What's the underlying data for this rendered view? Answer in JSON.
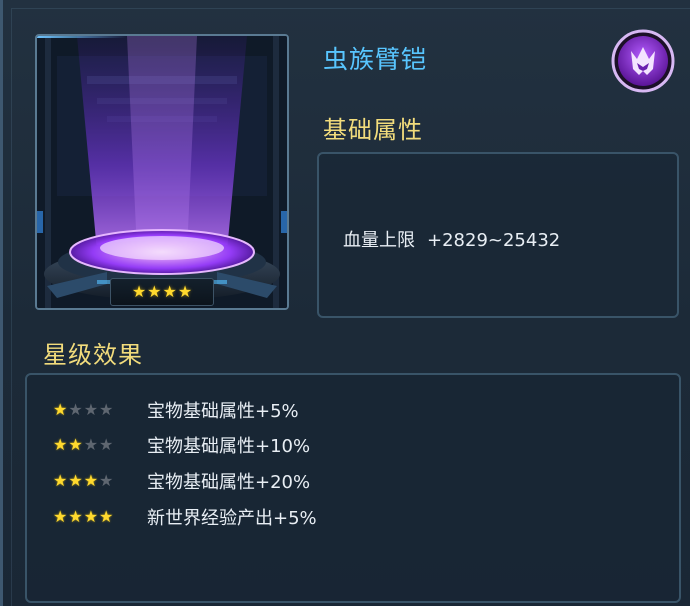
{
  "item": {
    "name": "虫族臂铠",
    "star_count": 4,
    "stars": "★★★★",
    "emblem_icon": "purple-zerg-emblem-icon"
  },
  "base_attributes": {
    "label": "基础属性",
    "rows": [
      {
        "name": "血量上限",
        "value": "+2829~25432"
      }
    ]
  },
  "star_effects": {
    "label": "星级效果",
    "rows": [
      {
        "stars_on": 1,
        "stars_total": 4,
        "text": "宝物基础属性+5%"
      },
      {
        "stars_on": 2,
        "stars_total": 4,
        "text": "宝物基础属性+10%"
      },
      {
        "stars_on": 3,
        "stars_total": 4,
        "text": "宝物基础属性+20%"
      },
      {
        "stars_on": 4,
        "stars_total": 4,
        "text": "新世界经验产出+5%"
      }
    ]
  },
  "colors": {
    "item_name": "#58c6ff",
    "section_label": "#f2dc7c",
    "star_active": "#ffd92e",
    "star_inactive": "#5e6670",
    "glow": "#a040ff"
  }
}
